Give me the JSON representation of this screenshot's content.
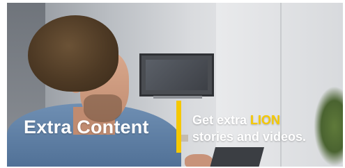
{
  "banner": {
    "headline": "Extra Content",
    "tagline_prefix": "Get extra ",
    "tagline_brand": "LION",
    "tagline_suffix": "stories and videos.",
    "accent_color": "#f5c800"
  }
}
